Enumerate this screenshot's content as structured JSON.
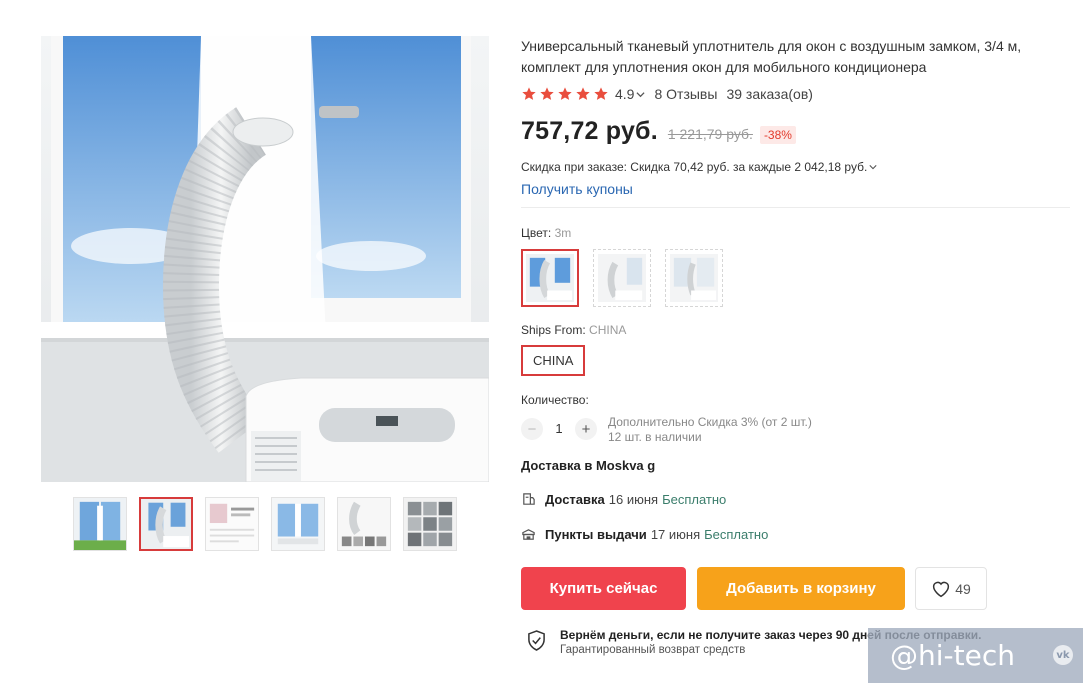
{
  "product": {
    "title": "Универсальный тканевый уплотнитель для окон с воздушным замком, 3/4 м, комплект для уплотнения окон для мобильного кондиционера",
    "rating": "4.9",
    "rating_fraction": 0.98,
    "reviews": "8 Отзывы",
    "orders": "39 заказа(ов)",
    "price": "757,72 руб.",
    "old_price": "1 221,79 руб.",
    "discount": "-38%",
    "promo": "Скидка при заказе: Скидка 70,42 руб. за каждые 2 042,18 руб.",
    "coupons": "Получить купоны"
  },
  "color": {
    "label": "Цвет:",
    "selected": "3m"
  },
  "ships": {
    "label": "Ships From:",
    "selected": "CHINA",
    "option": "CHINA"
  },
  "quantity": {
    "label": "Количество:",
    "value": "1",
    "minus": "−",
    "plus": "+",
    "extra_discount": "Дополнительно Скидка 3% (от 2 шт.)",
    "stock": "12 шт. в наличии"
  },
  "delivery": {
    "title": "Доставка в Moskva g",
    "options": [
      {
        "name": "Доставка",
        "date": "16 июня",
        "price": "Бесплатно",
        "icon": "truck-icon"
      },
      {
        "name": "Пункты выдачи",
        "date": "17 июня",
        "price": "Бесплатно",
        "icon": "pickup-icon"
      }
    ]
  },
  "actions": {
    "buy": "Купить сейчас",
    "cart": "Добавить в корзину",
    "wishlist_count": "49"
  },
  "guarantee": {
    "title": "Вернём деньги, если не получите заказ через 90 дней после отправки.",
    "subtitle": "Гарантированный возврат средств"
  },
  "watermark": {
    "text": "@hi-tech",
    "badge": "vk"
  },
  "colors": {
    "accent_red": "#f0434d",
    "accent_orange": "#f7a21a",
    "star": "#e94d3d",
    "link": "#2a67b2",
    "free": "#3a7d6b"
  }
}
